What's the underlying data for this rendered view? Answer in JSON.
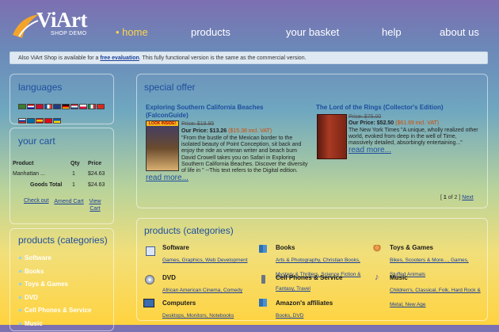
{
  "logo": {
    "brand": "ViArt",
    "subtitle": "SHOP DEMO"
  },
  "nav": {
    "home": "• home",
    "products": "products",
    "basket": "your basket",
    "help": "help",
    "about": "about us"
  },
  "notice": {
    "prefix": "Also ViArt Shop is available for a ",
    "link": "free evaluation",
    "suffix": ". This fully functional version is the same as the commercial version."
  },
  "languages": {
    "title": "languages"
  },
  "cart": {
    "title": "your cart",
    "headers": {
      "product": "Product",
      "qty": "Qty",
      "price": "Price"
    },
    "row": {
      "product": "Manhattan ...",
      "qty": "1",
      "price": "$24.63"
    },
    "total_label": "Goods Total",
    "total_qty": "1",
    "total_price": "$24.63",
    "links": {
      "checkout": "Check out",
      "amend": "Amend Cart",
      "view": "View Cart"
    }
  },
  "side_categories": {
    "title": "products (categories)",
    "items": [
      "Software",
      "Books",
      "Toys & Games",
      "DVD",
      "Cell Phones & Service",
      "Music"
    ]
  },
  "special_offer": {
    "title": "special offer",
    "items": [
      {
        "title_line1": "Exploring Southern California Beaches",
        "title_line2": "(FalconGuide)",
        "old_price": "Price: $18.95",
        "our_price": "Our Price: $13.26",
        "vat": "($15.38 incl. VAT)",
        "desc_lines": [
          "\"From the bustle of the Mexican border to the",
          "isolated beauty of Point Conception, sit back and",
          "enjoy the ride as veteran writer and beach bum",
          "David Crowell takes you on Safari in Exploring",
          "Southern California Beaches. Discover the diversity",
          "of life in \" --This text refers to the Digital edition."
        ],
        "read_more": "read more...",
        "cover_badge": "LOOK INSIDE!"
      },
      {
        "title_line1": "The Lord of the Rings (Collector's Edition)",
        "old_price": "Price: $75.00",
        "our_price": "Our Price: $52.50",
        "vat": "($61.69 incl. VAT)",
        "desc_lines": [
          "The New York Times \"A unique, wholly realized other",
          "world, evoked from deep in the well of Time,",
          "massively detailed, absorbingly entertaining...\""
        ],
        "read_more": "read more..."
      }
    ],
    "pager": {
      "open": "[ ",
      "current": "1",
      "of": " of ",
      "total": "2",
      "close": " ] ",
      "next": "Next"
    }
  },
  "main_categories": {
    "title": "products (categories)",
    "items": [
      {
        "name": "Software",
        "icon": "software-icon",
        "subs": "Games, Graphics, Web Development"
      },
      {
        "name": "Books",
        "icon": "books-icon",
        "subs": "Arts & Photography, Christian Books, Mystery & Thrillers, Science Fiction & Fantasy, Travel"
      },
      {
        "name": "Toys & Games",
        "icon": "toys-icon",
        "subs": "Bikes, Scooters & More..., Games, Stuffed Animals"
      },
      {
        "name": "DVD",
        "icon": "dvd-icon",
        "subs": "African American Cinema, Comedy"
      },
      {
        "name": "Cell Phones & Service",
        "icon": "phone-icon",
        "subs": ""
      },
      {
        "name": "Music",
        "icon": "music-icon",
        "subs": "Children's, Classical, Folk, Hard Rock & Metal, New Age"
      },
      {
        "name": "Computers",
        "icon": "computer-icon",
        "subs": "Desktops, Monitors, Notebooks"
      },
      {
        "name": "Amazon's affiliates",
        "icon": "affiliates-icon",
        "subs": "Books, DVD"
      }
    ]
  },
  "colors": {
    "accent": "#ffd54a",
    "title_blue": "#1d4e9f",
    "vat_orange": "#d04a00"
  }
}
